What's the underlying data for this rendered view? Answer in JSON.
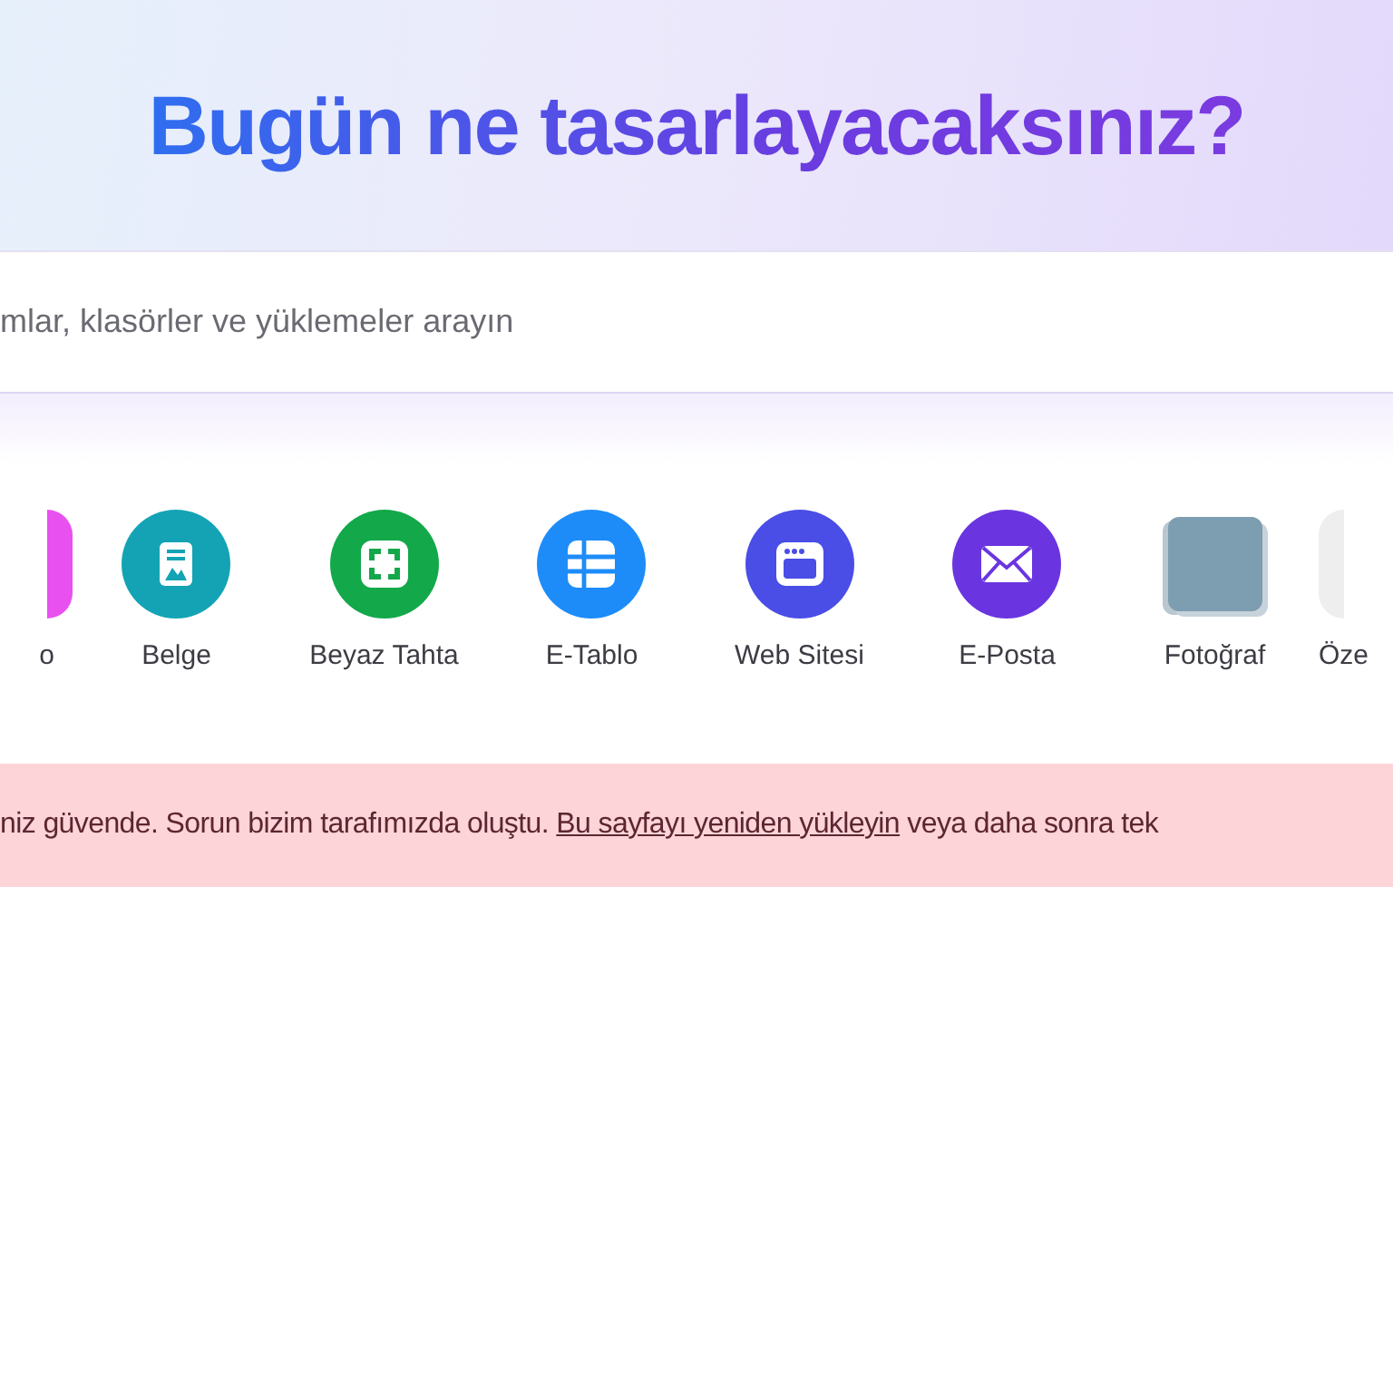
{
  "header": {
    "title": "Bugün ne tasarlayacaksınız?"
  },
  "search": {
    "placeholder": "mlar, klasörler ve yüklemeler arayın"
  },
  "categories": [
    {
      "label": "o",
      "kind": "cut-left",
      "color": "#e950f0"
    },
    {
      "label": "Belge",
      "kind": "doc",
      "color": "#13a3b5"
    },
    {
      "label": "Beyaz Tahta",
      "kind": "whiteboard",
      "color": "#13a84a"
    },
    {
      "label": "E-Tablo",
      "kind": "sheet",
      "color": "#1d8cf8"
    },
    {
      "label": "Web Sitesi",
      "kind": "web",
      "color": "#4a4de6"
    },
    {
      "label": "E-Posta",
      "kind": "mail",
      "color": "#6a35e0"
    },
    {
      "label": "Fotoğraf",
      "kind": "photo",
      "color": "#7d9db0"
    },
    {
      "label": "Öze",
      "kind": "cut-right",
      "color": "#eeeeee"
    }
  ],
  "error_banner": {
    "before": "niz güvende. Sorun bizim tarafımızda oluştu. ",
    "link": "Bu sayfayı yeniden yükleyin",
    "after": " veya daha sonra tek"
  }
}
